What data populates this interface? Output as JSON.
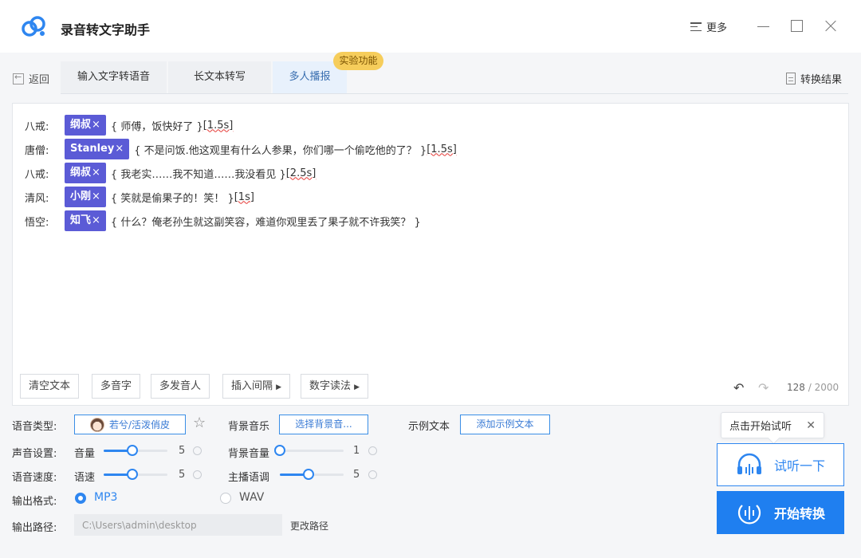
{
  "app": {
    "title": "录音转文字助手",
    "more_label": "更多"
  },
  "nav": {
    "back_label": "返回",
    "tabs": [
      {
        "label": "输入文字转语音"
      },
      {
        "label": "长文本转写"
      },
      {
        "label": "多人播报"
      }
    ],
    "experimental_badge": "实验功能",
    "result_label": "转换结果"
  },
  "script": [
    {
      "speaker": "八戒:",
      "voice": "纲叔",
      "text": "{ 师傅，饭快好了 }",
      "pause": "[1.5s]"
    },
    {
      "speaker": "唐僧:",
      "voice": "Stanley",
      "text": "{ 不是问饭.他这观里有什么人参果，你们哪一个偷吃他的了？ }",
      "pause": "[1.5s]"
    },
    {
      "speaker": "八戒:",
      "voice": "纲叔",
      "text": "{ 我老实……我不知道……我没看见 }",
      "pause": "[2.5s]"
    },
    {
      "speaker": "清风:",
      "voice": "小刚",
      "text": "{ 笑就是偷果子的！笑！ }",
      "pause": "[1s]"
    },
    {
      "speaker": "悟空:",
      "voice": "知飞",
      "text": "{ 什么？俺老孙生就这副笑容，难道你观里丢了果子就不许我笑？ }",
      "pause": ""
    }
  ],
  "tag_remove_symbol": "×",
  "toolbar": {
    "clear_text": "清空文本",
    "polyphone": "多音字",
    "multi_speaker": "多发音人",
    "insert_pause": "插入间隔",
    "number_reading": "数字读法",
    "char_count": "128",
    "char_max": " / 2000"
  },
  "settings": {
    "voice_type_label": "语音类型:",
    "voice_value": "若兮/活泼俏皮",
    "bg_music_label": "背景音乐",
    "bg_music_button": "选择背景音...",
    "example_text_label": "示例文本",
    "example_text_button": "添加示例文本",
    "sound_label": "声音设置:",
    "volume_label": "音量",
    "volume_value": "5",
    "volume_max": 10,
    "bg_volume_label": "背景音量",
    "bg_volume_value": "1",
    "speed_label": "语音速度:",
    "speed_sub_label": "语速",
    "speed_value": "5",
    "pitch_label": "主播语调",
    "pitch_value": "5",
    "format_label": "输出格式:",
    "format_options": [
      "MP3",
      "WAV"
    ],
    "format_selected": "MP3",
    "path_label": "输出路径:",
    "path_value": "C:\\Users\\admin\\desktop",
    "change_path": "更改路径"
  },
  "actions": {
    "tooltip": "点击开始试听",
    "tooltip_close": "✕",
    "listen_label": "试听一下",
    "convert_label": "开始转换"
  },
  "colors": {
    "accent": "#1f7ff0",
    "voice_tag": "#5b5bd6",
    "badge": "#f6cd5b"
  }
}
